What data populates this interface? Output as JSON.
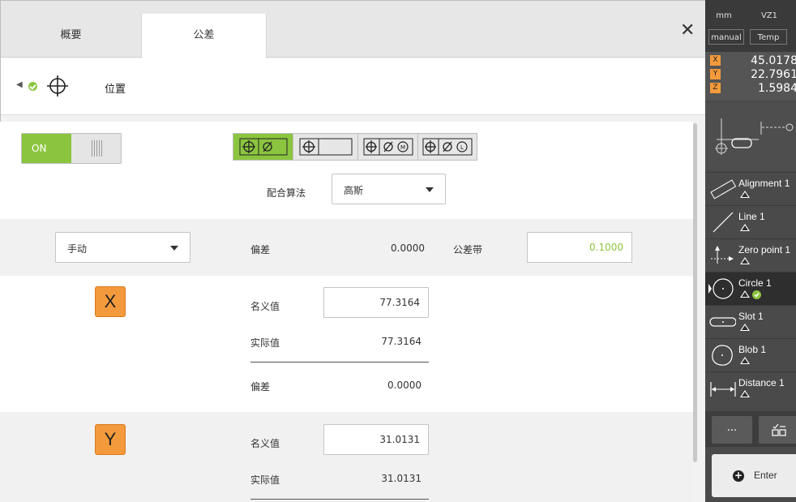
{
  "tabs": [
    {
      "label": "概要",
      "active": false
    },
    {
      "label": "公差",
      "active": true
    }
  ],
  "close_label": "✕",
  "breadcrumb": {
    "title": "位置"
  },
  "toggle": {
    "label": "ON",
    "state": "on"
  },
  "fit_algorithm": {
    "label": "配合算法",
    "value": "高斯"
  },
  "mode_select": {
    "value": "手动"
  },
  "deviation_row": {
    "label": "偏差",
    "value": "0.0000",
    "tol_label": "公差带",
    "tol_value": "0.1000"
  },
  "axes": [
    {
      "axis": "X",
      "nominal_label": "名义值",
      "nominal": "77.3164",
      "actual_label": "实际值",
      "actual": "77.3164",
      "deviation_label": "偏差",
      "deviation": "0.0000"
    },
    {
      "axis": "Y",
      "nominal_label": "名义值",
      "nominal": "31.0131",
      "actual_label": "实际值",
      "actual": "31.0131"
    }
  ],
  "sidebar": {
    "unit": "mm",
    "zone": "VZ1",
    "mode": "manual",
    "temp": "Temp",
    "coords": [
      {
        "axis": "X",
        "value": "45.0178"
      },
      {
        "axis": "Y",
        "value": "22.7961"
      },
      {
        "axis": "Z",
        "value": "1.5984"
      }
    ],
    "features": [
      {
        "name": "Alignment 1",
        "icon": "alignment-icon"
      },
      {
        "name": "Line 1",
        "icon": "line-icon"
      },
      {
        "name": "Zero point 1",
        "icon": "zero-point-icon"
      },
      {
        "name": "Circle 1",
        "icon": "circle-icon",
        "selected": true
      },
      {
        "name": "Slot 1",
        "icon": "slot-icon"
      },
      {
        "name": "Blob 1",
        "icon": "blob-icon"
      },
      {
        "name": "Distance 1",
        "icon": "distance-icon"
      }
    ],
    "more_label": "...",
    "enter_label": "Enter"
  },
  "colors": {
    "accent_green": "#8bc53f",
    "axis_orange": "#f39a3c",
    "sidebar_dark": "#4a4a4a"
  }
}
